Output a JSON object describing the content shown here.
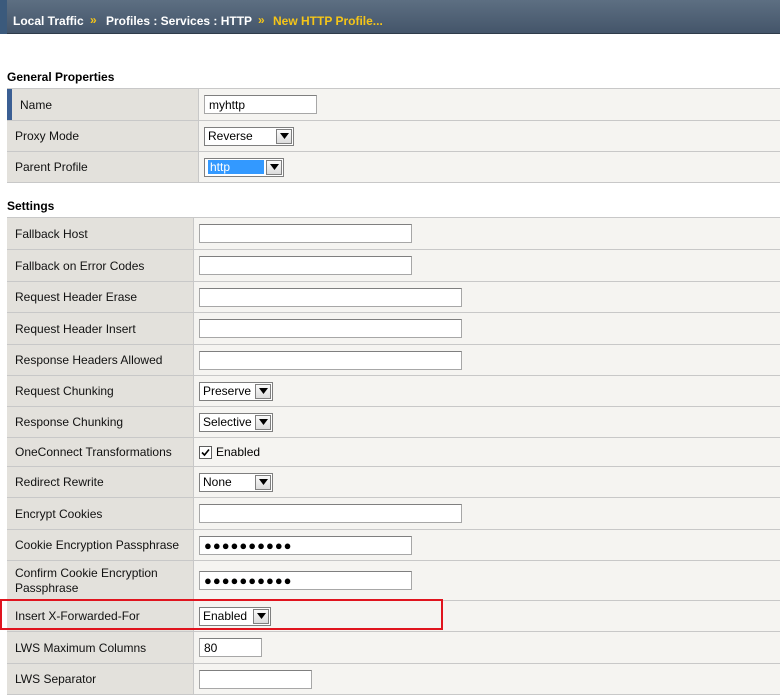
{
  "breadcrumb": {
    "items": [
      "Local Traffic",
      "Profiles : Services : HTTP",
      "New HTTP Profile..."
    ],
    "separator": "»"
  },
  "general": {
    "title": "General Properties",
    "name_label": "Name",
    "name_value": "myhttp",
    "proxy_mode_label": "Proxy Mode",
    "proxy_mode_value": "Reverse",
    "parent_profile_label": "Parent Profile",
    "parent_profile_value": "http"
  },
  "settings": {
    "title": "Settings",
    "fallback_host_label": "Fallback Host",
    "fallback_host_value": "",
    "fallback_error_codes_label": "Fallback on Error Codes",
    "fallback_error_codes_value": "",
    "request_header_erase_label": "Request Header Erase",
    "request_header_erase_value": "",
    "request_header_insert_label": "Request Header Insert",
    "request_header_insert_value": "",
    "response_headers_allowed_label": "Response Headers Allowed",
    "response_headers_allowed_value": "",
    "request_chunking_label": "Request Chunking",
    "request_chunking_value": "Preserve",
    "response_chunking_label": "Response Chunking",
    "response_chunking_value": "Selective",
    "oneconnect_label": "OneConnect Transformations",
    "oneconnect_checkbox_label": "Enabled",
    "oneconnect_checked": true,
    "redirect_rewrite_label": "Redirect Rewrite",
    "redirect_rewrite_value": "None",
    "encrypt_cookies_label": "Encrypt Cookies",
    "encrypt_cookies_value": "",
    "cookie_passphrase_label": "Cookie Encryption Passphrase",
    "cookie_passphrase_value": "●●●●●●●●●●",
    "confirm_passphrase_label": "Confirm Cookie Encryption Passphrase",
    "confirm_passphrase_value": "●●●●●●●●●●",
    "insert_xff_label": "Insert X-Forwarded-For",
    "insert_xff_value": "Enabled",
    "lws_max_columns_label": "LWS Maximum Columns",
    "lws_max_columns_value": "80",
    "lws_separator_label": "LWS Separator",
    "lws_separator_value": ""
  },
  "colors": {
    "highlight": "#e0141e",
    "breadcrumb_current": "#f5c518",
    "selected_option": "#3399ff"
  }
}
